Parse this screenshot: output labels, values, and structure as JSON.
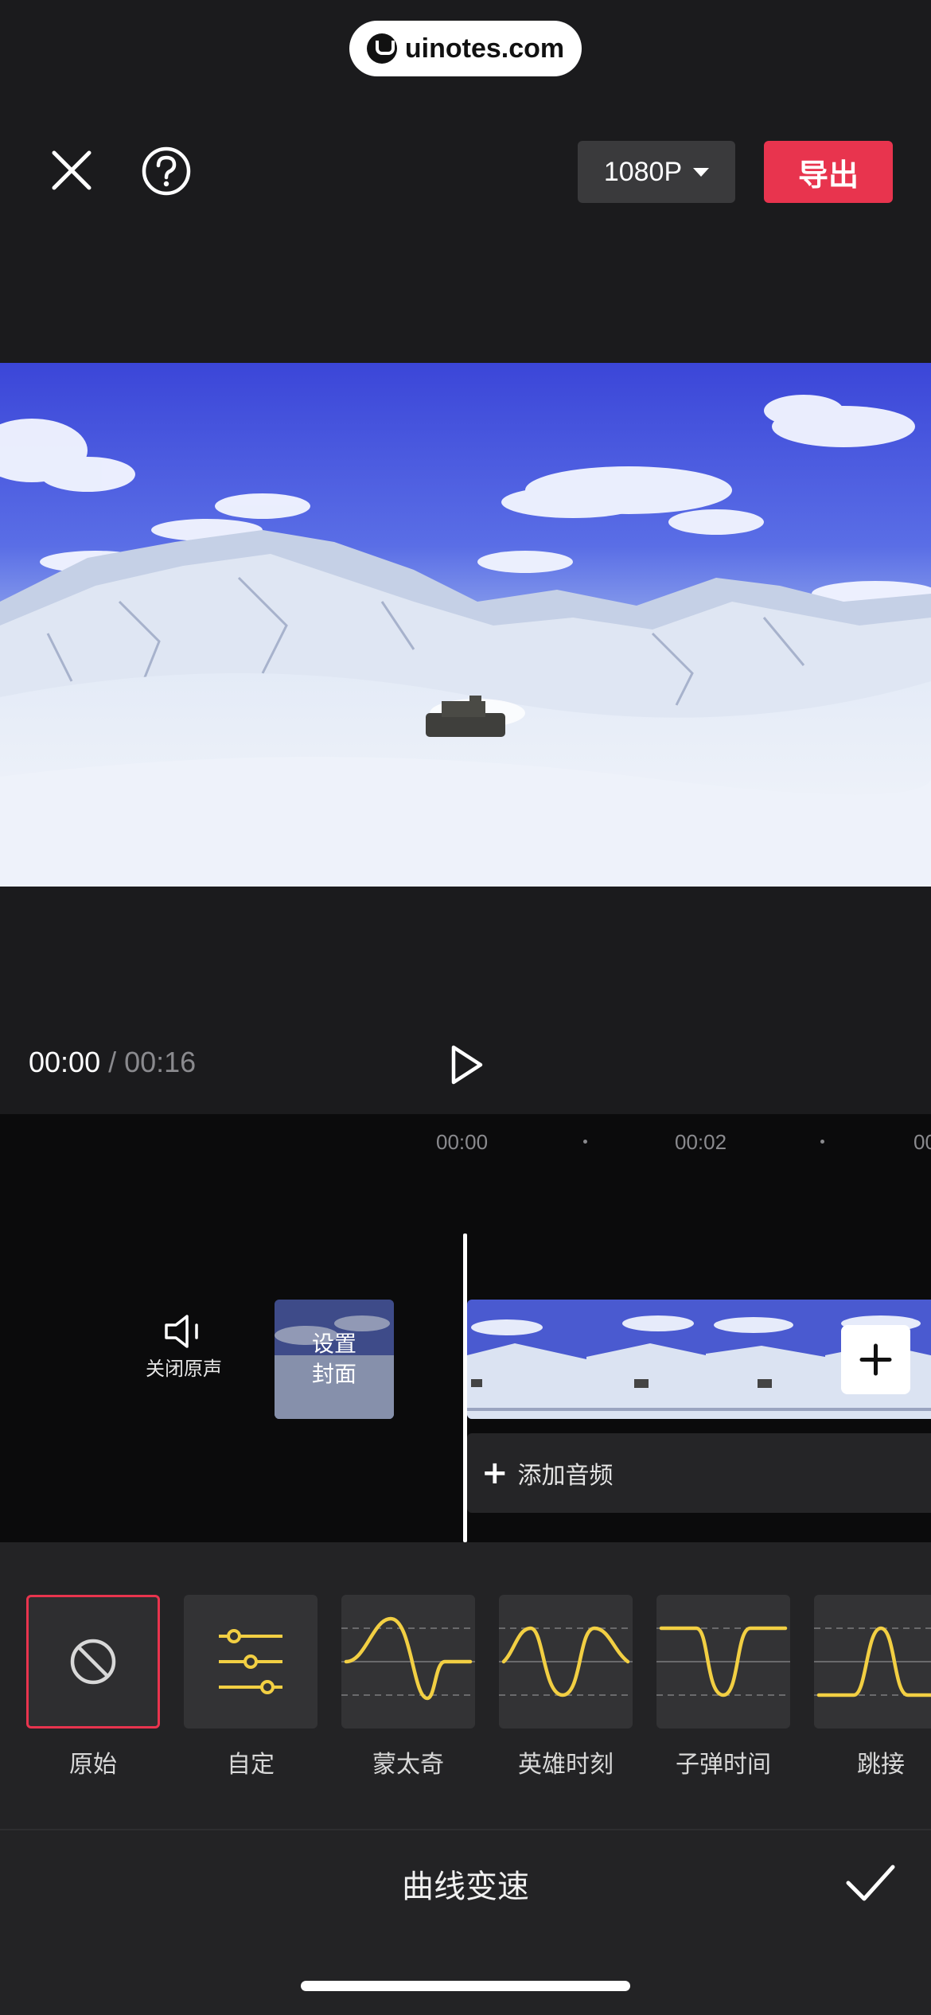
{
  "watermark": {
    "text": "uinotes.com"
  },
  "toolbar": {
    "resolution_label": "1080P",
    "export_label": "导出"
  },
  "player": {
    "current_time": "00:00",
    "separator": "/",
    "total_time": "00:16"
  },
  "ruler": {
    "marks": [
      "00:00",
      "00:02",
      "00"
    ]
  },
  "timeline": {
    "mute_label": "关闭原声",
    "cover_line1": "设置",
    "cover_line2": "封面",
    "add_audio_label": "添加音频"
  },
  "speed_presets": [
    {
      "label": "原始",
      "icon": "no-symbol-icon",
      "selected": true
    },
    {
      "label": "自定",
      "icon": "sliders-icon",
      "selected": false
    },
    {
      "label": "蒙太奇",
      "icon": "curve-montage-icon",
      "selected": false
    },
    {
      "label": "英雄时刻",
      "icon": "curve-hero-icon",
      "selected": false
    },
    {
      "label": "子弹时间",
      "icon": "curve-bullet-icon",
      "selected": false
    },
    {
      "label": "跳接",
      "icon": "curve-jumpcut-icon",
      "selected": false
    }
  ],
  "panel": {
    "title": "曲线变速"
  },
  "colors": {
    "accent": "#e8344e",
    "curve": "#f2cf43",
    "background": "#1b1b1d"
  }
}
